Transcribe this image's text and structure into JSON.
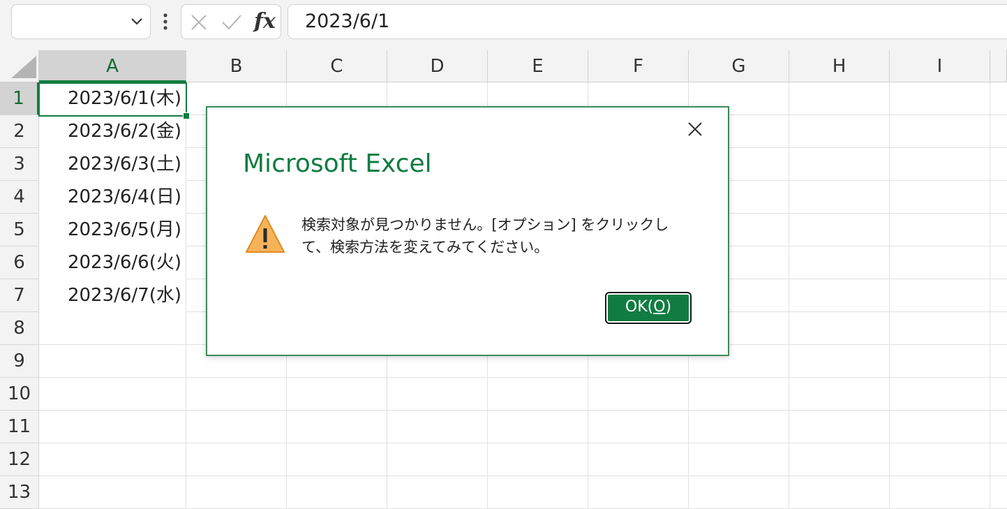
{
  "formula_bar": {
    "name_box": "",
    "fx_label": "fx",
    "formula": "2023/6/1"
  },
  "columns": [
    "A",
    "B",
    "C",
    "D",
    "E",
    "F",
    "G",
    "H",
    "I"
  ],
  "rows": [
    "1",
    "2",
    "3",
    "4",
    "5",
    "6",
    "7",
    "8",
    "9",
    "10",
    "11",
    "12",
    "13"
  ],
  "cells_a": [
    "2023/6/1(木)",
    "2023/6/2(金)",
    "2023/6/3(土)",
    "2023/6/4(日)",
    "2023/6/5(月)",
    "2023/6/6(火)",
    "2023/6/7(水)"
  ],
  "dialog": {
    "title": "Microsoft Excel",
    "message": "検索対象が見つかりません。[オプション] をクリックして、検索方法を変えてみてください。",
    "ok_label": "OK(",
    "ok_mnemonic": "O",
    "ok_close": ")"
  },
  "colors": {
    "accent": "#107c41",
    "warning": "#f2a33a"
  },
  "icons": [
    "chevron-down-icon",
    "more-dots-icon",
    "cancel-x-icon",
    "enter-check-icon",
    "function-fx-icon",
    "select-all-icon",
    "close-icon",
    "warning-icon"
  ]
}
